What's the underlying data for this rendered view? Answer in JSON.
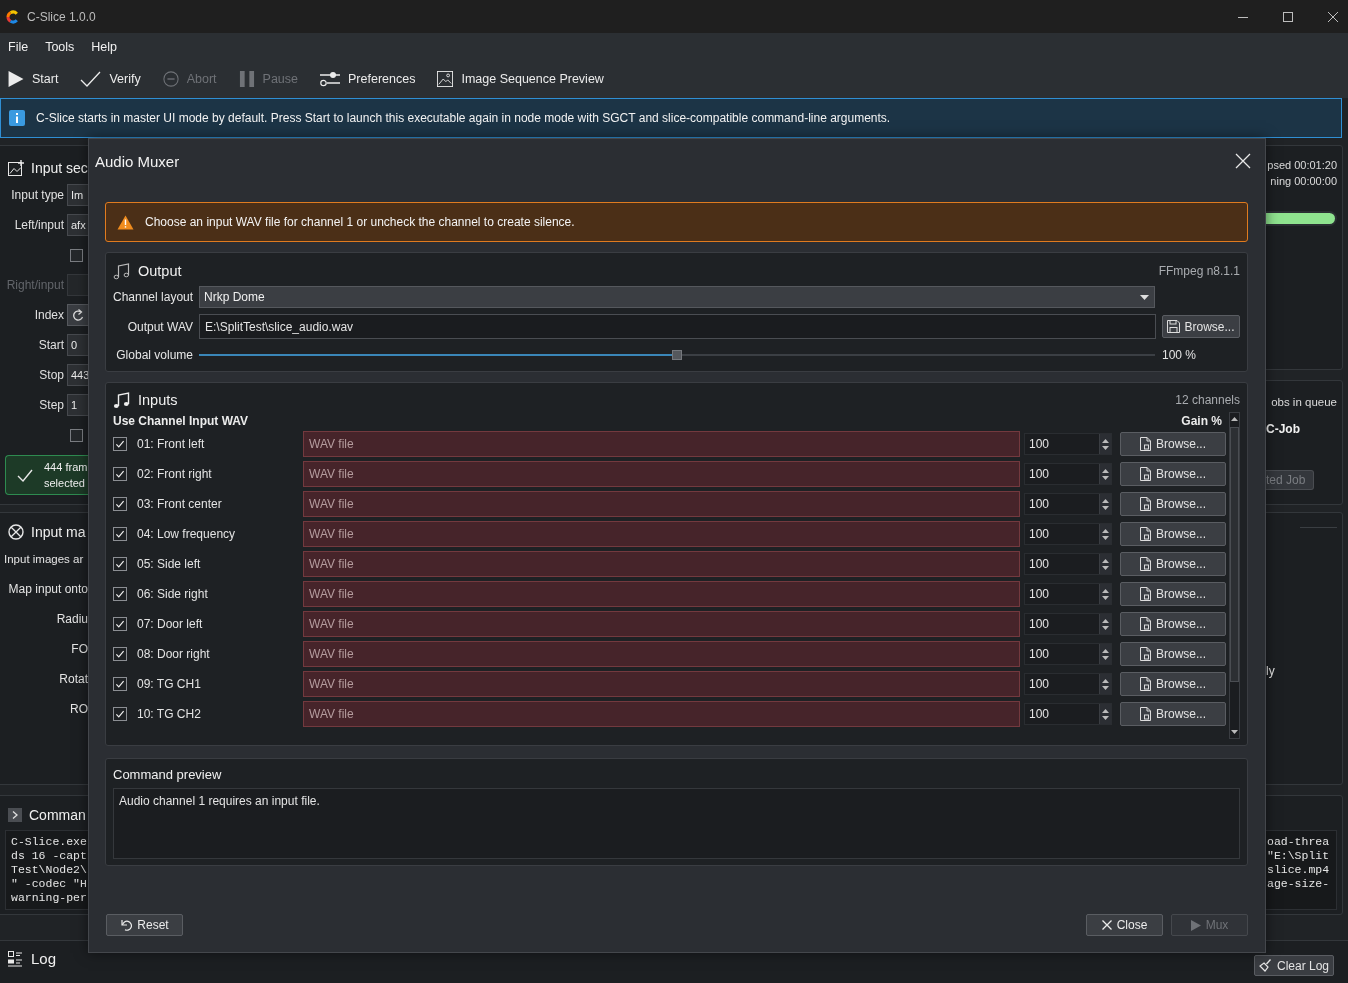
{
  "window": {
    "title": "C-Slice 1.0.0"
  },
  "menu": [
    {
      "label": "File"
    },
    {
      "label": "Tools"
    },
    {
      "label": "Help"
    }
  ],
  "toolbar": [
    {
      "kind": "play",
      "label": "Start",
      "disabled": false
    },
    {
      "kind": "check",
      "label": "Verify",
      "disabled": false
    },
    {
      "kind": "abort",
      "label": "Abort",
      "disabled": true
    },
    {
      "kind": "pause",
      "label": "Pause",
      "disabled": true
    },
    {
      "kind": "sliders",
      "label": "Preferences",
      "disabled": false
    },
    {
      "kind": "image",
      "label": "Image Sequence Preview",
      "disabled": false
    }
  ],
  "info_bar": {
    "text": "C-Slice starts in master UI mode by default. Press Start to launch this executable again in node mode with SGCT and slice-compatible command-line arguments."
  },
  "input_panel": {
    "title": "Input sec",
    "rows": [
      {
        "kind": "field",
        "label": "Input type",
        "value": "Im",
        "disabled": false
      },
      {
        "kind": "field",
        "label": "Left/input",
        "value": "afx",
        "disabled": false
      },
      {
        "kind": "checkbox",
        "checked": false
      },
      {
        "kind": "field",
        "label": "Right/input",
        "disabled": true
      },
      {
        "kind": "button",
        "label": "Index"
      },
      {
        "kind": "field",
        "label": "Start",
        "value": "0",
        "disabled": false
      },
      {
        "kind": "field",
        "label": "Stop",
        "value": "443",
        "disabled": false
      },
      {
        "kind": "field",
        "label": "Step",
        "value": "1",
        "disabled": false
      },
      {
        "kind": "checkbox",
        "checked": false
      }
    ],
    "status": [
      "444 fram",
      "selected"
    ]
  },
  "mapping_panel": {
    "title": "Input ma",
    "rows": [
      {
        "kind": "note",
        "label": "Input images ar"
      },
      {
        "kind": "label",
        "label": "Map input onto"
      },
      {
        "kind": "label",
        "label": "Radiu"
      },
      {
        "kind": "label",
        "label": "FO"
      },
      {
        "kind": "label",
        "label": "Rotat"
      },
      {
        "kind": "label",
        "label": "RO"
      }
    ]
  },
  "command_panel": {
    "title": "Comman",
    "lines": [
      "C-Slice.exe",
      "ds 16 -capt",
      "Test\\Node2\\",
      "\" -codec \"H",
      "warning-per"
    ]
  },
  "progress_panel": {
    "elapsed": "psed 00:01:20",
    "remaining": "ning 00:00:00",
    "progress": {
      "level": 1
    }
  },
  "queue_panel": {
    "caption": "obs in queue",
    "job": "C-Job",
    "button": {
      "label": "ted Job",
      "disabled": true
    }
  },
  "side_panel": {
    "text": "ly"
  },
  "side_command": {
    "lines": [
      "oad-threa",
      "\"E:\\Split",
      "slice.mp4",
      "age-size-"
    ]
  },
  "log_panel": {
    "title": "Log",
    "button": "Clear Log"
  },
  "dialog": {
    "title": "Audio Muxer",
    "warning": "Choose an input WAV file for channel 1 or uncheck the channel to create silence.",
    "output": {
      "title": "Output",
      "version": "FFmpeg n8.1.1",
      "channel_layout": {
        "label": "Channel layout",
        "value": "Nrkp Dome"
      },
      "output_wav": {
        "label": "Output WAV",
        "value": "E:\\SplitTest\\slice_audio.wav",
        "button": "Browse..."
      },
      "global_volume": {
        "label": "Global volume",
        "level": 0.5,
        "reading": "100 %"
      }
    },
    "inputs": {
      "title": "Inputs",
      "count": "12 channels",
      "columns": [
        "Use Channel Input WAV",
        "Gain %"
      ],
      "channels": [
        {
          "name": "01: Front left",
          "checked": true,
          "invalid": true,
          "placeholder": "WAV file",
          "gain": "100",
          "button": "Browse..."
        },
        {
          "name": "02: Front right",
          "checked": true,
          "invalid": true,
          "placeholder": "WAV file",
          "gain": "100",
          "button": "Browse..."
        },
        {
          "name": "03: Front center",
          "checked": true,
          "invalid": true,
          "placeholder": "WAV file",
          "gain": "100",
          "button": "Browse..."
        },
        {
          "name": "04: Low frequency",
          "checked": true,
          "invalid": true,
          "placeholder": "WAV file",
          "gain": "100",
          "button": "Browse..."
        },
        {
          "name": "05: Side left",
          "checked": true,
          "invalid": true,
          "placeholder": "WAV file",
          "gain": "100",
          "button": "Browse..."
        },
        {
          "name": "06: Side right",
          "checked": true,
          "invalid": true,
          "placeholder": "WAV file",
          "gain": "100",
          "button": "Browse..."
        },
        {
          "name": "07: Door left",
          "checked": true,
          "invalid": true,
          "placeholder": "WAV file",
          "gain": "100",
          "button": "Browse..."
        },
        {
          "name": "08: Door right",
          "checked": true,
          "invalid": true,
          "placeholder": "WAV file",
          "gain": "100",
          "button": "Browse..."
        },
        {
          "name": "09: TG CH1",
          "checked": true,
          "invalid": true,
          "placeholder": "WAV file",
          "gain": "100",
          "button": "Browse..."
        },
        {
          "name": "10: TG CH2",
          "checked": true,
          "invalid": true,
          "placeholder": "WAV file",
          "gain": "100",
          "button": "Browse..."
        }
      ]
    },
    "command_preview": {
      "title": "Command preview",
      "text": "Audio channel 1 requires an input file."
    },
    "buttons": [
      {
        "kind": "reset",
        "label": "Reset",
        "disabled": false
      },
      {
        "kind": "close",
        "label": "Close",
        "disabled": false
      },
      {
        "kind": "play",
        "label": "Mux",
        "disabled": true
      }
    ]
  }
}
